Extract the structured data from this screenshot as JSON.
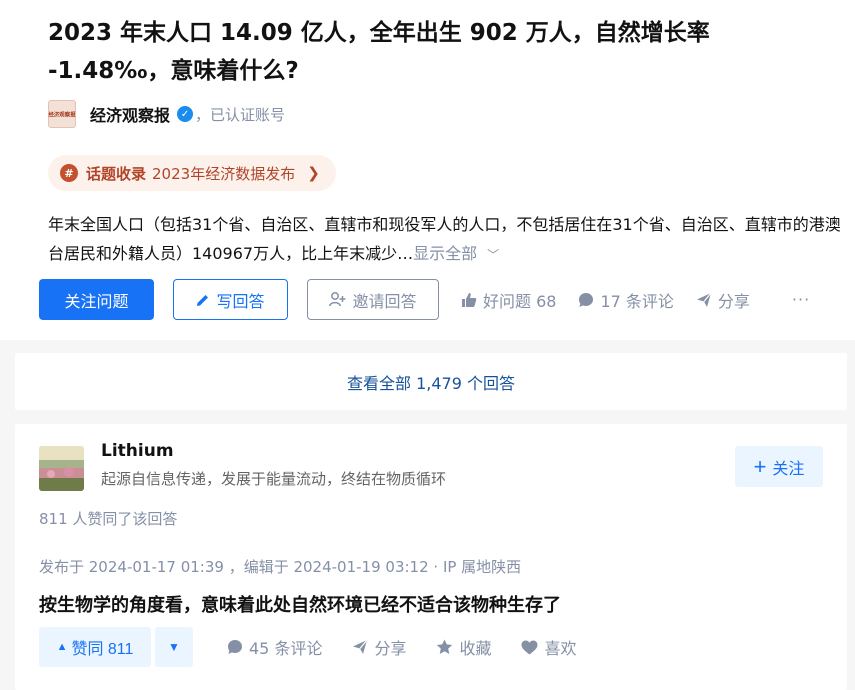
{
  "question": {
    "title": "2023 年末人口 14.09 亿人，全年出生 902 万人，自然增长率 -1.48‰，意味着什么?",
    "author": {
      "logo_text": "经济观察报",
      "name": "经济观察报",
      "verified_text": "，已认证账号"
    },
    "topic": {
      "icon": "#",
      "label": "话题收录",
      "name": "2023年经济数据发布",
      "arrow": "❯"
    },
    "description": "年末全国人口（包括31个省、自治区、直辖市和现役军人的人口，不包括居住在31个省、自治区、直辖市的港澳台居民和外籍人员）140967万人，比上年末减少…",
    "show_all": "显示全部",
    "actions": {
      "follow": "关注问题",
      "write": "写回答",
      "invite": "邀请回答",
      "good_question": "好问题 68",
      "comments": "17 条评论",
      "share": "分享",
      "more": "···"
    }
  },
  "view_all": "查看全部 1,479 个回答",
  "answer": {
    "author_name": "Lithium",
    "author_bio": "起源自信息传递，发展于能量流动，终结在物质循环",
    "follow": "关注",
    "liked_by": "811 人赞同了该回答",
    "publish_info": "发布于 2024-01-17 01:39 ，编辑于 2024-01-19 03:12 · IP 属地陕西",
    "content": "按生物学的角度看，意味着此处自然环境已经不适合该物种生存了",
    "actions": {
      "upvote": "赞同 811",
      "comments": "45 条评论",
      "share": "分享",
      "collect": "收藏",
      "like": "喜欢"
    }
  },
  "colors": {
    "brand": "#1772f6",
    "topic": "#b1452a",
    "muted": "#8590a6"
  }
}
